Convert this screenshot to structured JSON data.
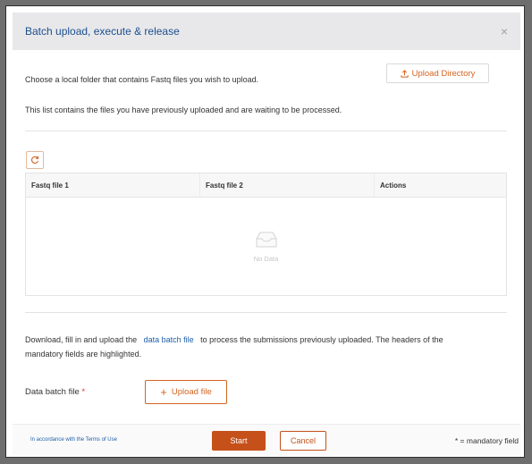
{
  "dialog": {
    "title": "Batch upload, execute & release",
    "close_glyph": "×"
  },
  "intro": {
    "choose_text": "Choose a local folder that contains Fastq files you wish to upload.",
    "upload_directory_label": "Upload Directory",
    "list_text": "This list contains the files you have previously uploaded and are waiting to be processed."
  },
  "toolbar": {
    "refresh_icon": "refresh-icon"
  },
  "table": {
    "columns": [
      "Fastq file 1",
      "Fastq file 2",
      "Actions"
    ],
    "empty_text": "No Data"
  },
  "batch": {
    "text_before": "Download, fill in and upload the",
    "link_text": "data batch file",
    "text_after": "to process the submissions previously uploaded. The headers of the",
    "text_line2": "mandatory fields are highlighted.",
    "field_label": "Data batch file",
    "required_mark": "*",
    "upload_file_label": "Upload file"
  },
  "footer": {
    "terms_link": "In accordance with the Terms of Use",
    "start_label": "Start",
    "cancel_label": "Cancel",
    "mandatory_note": "* = mandatory field"
  },
  "colors": {
    "accent": "#d46420",
    "primary_button": "#c5501a",
    "title": "#1c4f8c",
    "link": "#1f5fa8"
  }
}
